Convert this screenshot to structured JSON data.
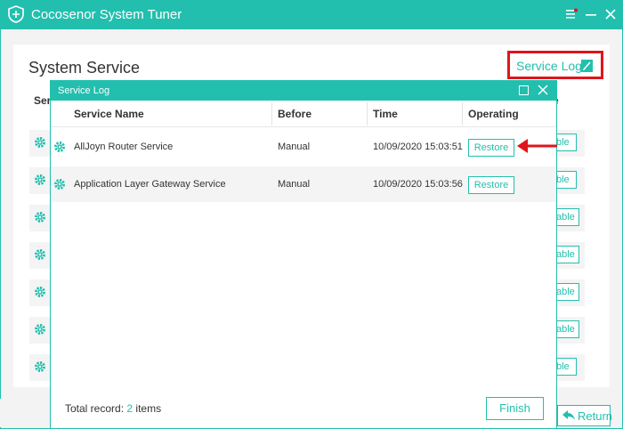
{
  "window": {
    "title": "Cocosenor System Tuner",
    "icons": {
      "logo": "shield-plus-icon",
      "menu": "menu-icon",
      "minimize": "minimize-icon",
      "close": "close-icon"
    }
  },
  "page": {
    "title": "System Service",
    "col_left_fragment": "Ser",
    "col_right_fragment": "e",
    "service_log_link": "Service Log",
    "background_buttons": [
      "ble",
      "ble",
      "able",
      "able",
      "able",
      "able",
      "ble"
    ]
  },
  "bottom": {
    "return_label": "Return"
  },
  "modal": {
    "title": "Service Log",
    "columns": [
      "Service Name",
      "Before",
      "Time",
      "Operating"
    ],
    "rows": [
      {
        "name": "AllJoyn Router Service",
        "before": "Manual",
        "time": "10/09/2020 15:03:51",
        "action": "Restore"
      },
      {
        "name": "Application Layer Gateway Service",
        "before": "Manual",
        "time": "10/09/2020 15:03:56",
        "action": "Restore"
      }
    ],
    "footer_prefix": "Total record:",
    "footer_count": "2",
    "footer_suffix": "items",
    "finish_label": "Finish"
  },
  "colors": {
    "accent": "#22bfae",
    "highlight": "#e0151b"
  }
}
